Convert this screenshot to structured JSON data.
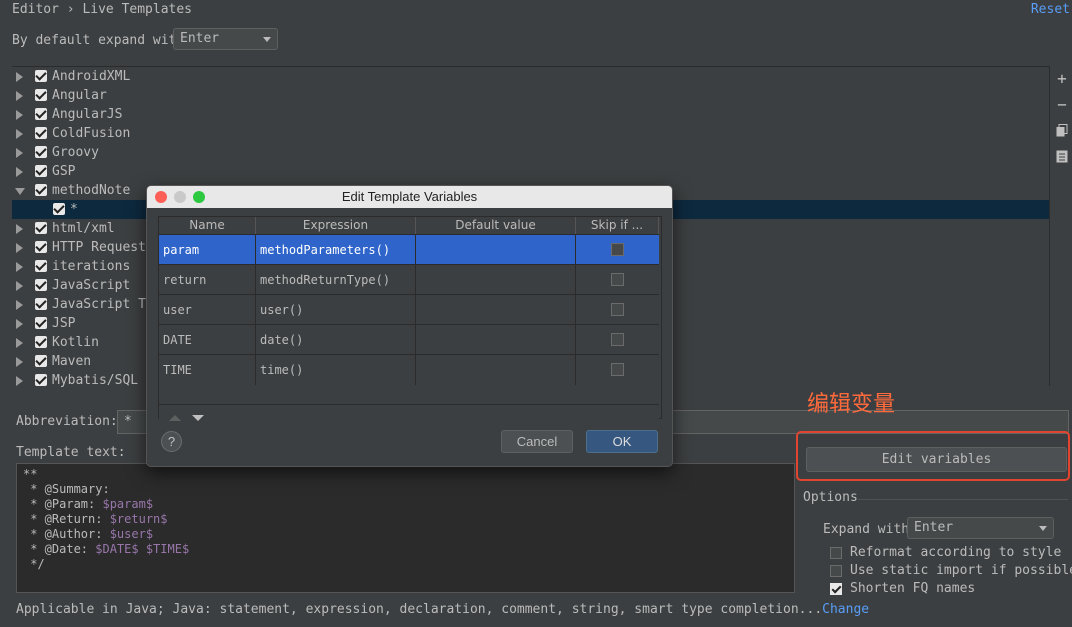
{
  "header": {
    "breadcrumb": "Editor › Live Templates",
    "reset_label": "Reset",
    "expand_label": "By default expand with",
    "expand_value": "Enter"
  },
  "tree": {
    "groups": [
      {
        "label": "AndroidXML"
      },
      {
        "label": "Angular"
      },
      {
        "label": "AngularJS"
      },
      {
        "label": "ColdFusion"
      },
      {
        "label": "Groovy"
      },
      {
        "label": "GSP"
      },
      {
        "label": "methodNote",
        "expanded": true
      },
      {
        "label": "*",
        "child": true,
        "selected": true
      },
      {
        "label": "html/xml"
      },
      {
        "label": "HTTP Request"
      },
      {
        "label": "iterations"
      },
      {
        "label": "JavaScript"
      },
      {
        "label": "JavaScript Te"
      },
      {
        "label": "JSP"
      },
      {
        "label": "Kotlin"
      },
      {
        "label": "Maven"
      },
      {
        "label": "Mybatis/SQL"
      }
    ]
  },
  "toolbar": {
    "add": "+",
    "remove": "−"
  },
  "editor": {
    "abbreviation_label": "Abbreviation:",
    "abbreviation_value": "*",
    "template_text_label": "Template text:",
    "template_lines": [
      {
        "text": "**"
      },
      {
        "text": " * @Summary:"
      },
      {
        "text": " * @Param: ",
        "var": "$param$"
      },
      {
        "text": " * @Return: ",
        "var": "$return$"
      },
      {
        "text": " * @Author: ",
        "var": "$user$"
      },
      {
        "text": " * @Date: ",
        "var": "$DATE$ $TIME$"
      },
      {
        "text": " */"
      }
    ],
    "annotation": "编辑变量",
    "edit_variables_label": "Edit variables",
    "applicable_text": "Applicable in Java; Java: statement, expression, declaration, comment, string, smart type completion...",
    "change_label": "Change"
  },
  "options": {
    "title": "Options",
    "expand_with_label": "Expand with",
    "expand_with_value": "Enter",
    "reformat_label": "Reformat according to style",
    "static_import_label": "Use static import if possible",
    "shorten_fq_label": "Shorten FQ names",
    "reformat_checked": false,
    "static_import_checked": false,
    "shorten_fq_checked": true
  },
  "dialog": {
    "title": "Edit Template Variables",
    "columns": [
      "Name",
      "Expression",
      "Default value",
      "Skip if ..."
    ],
    "rows": [
      {
        "name": "param",
        "expression": "methodParameters()",
        "default": "",
        "selected": true
      },
      {
        "name": "return",
        "expression": "methodReturnType()",
        "default": ""
      },
      {
        "name": "user",
        "expression": "user()",
        "default": ""
      },
      {
        "name": "DATE",
        "expression": "date()",
        "default": ""
      },
      {
        "name": "TIME",
        "expression": "time()",
        "default": ""
      }
    ],
    "help_label": "?",
    "cancel_label": "Cancel",
    "ok_label": "OK"
  },
  "colors": {
    "background": "#3c3f41",
    "selection": "#2f65ca",
    "link": "#589df6",
    "annotation": "#e2452f"
  }
}
